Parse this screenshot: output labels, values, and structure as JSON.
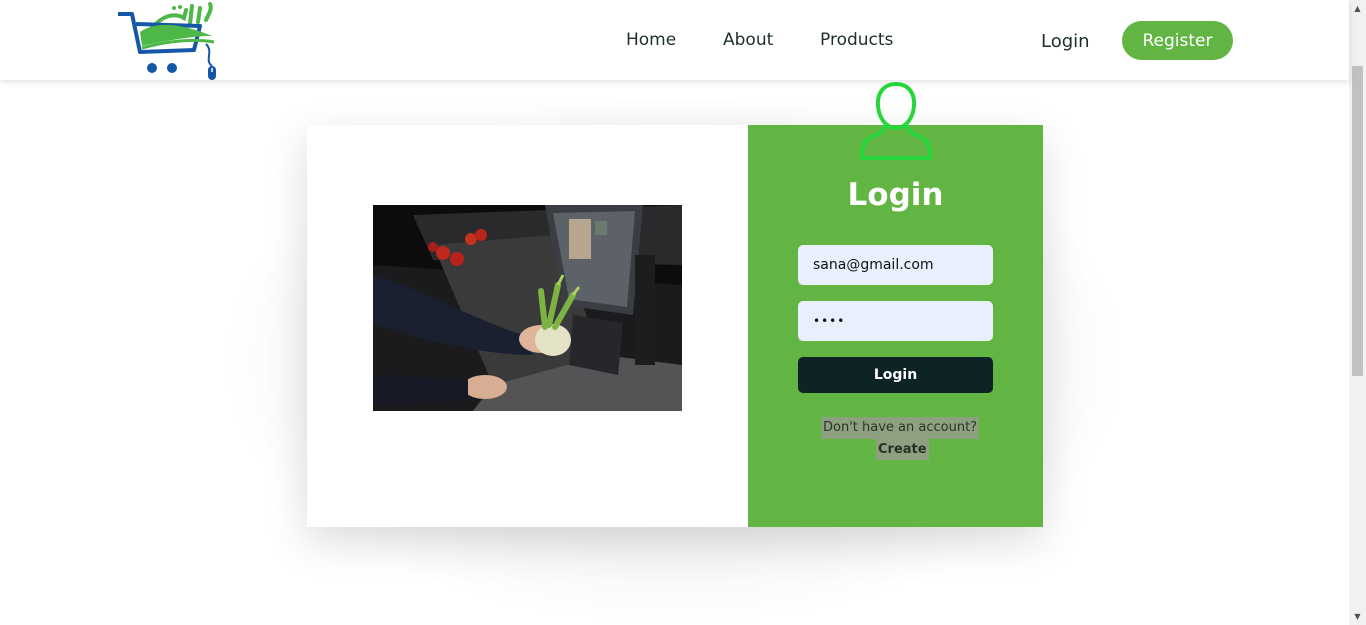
{
  "nav": {
    "links": [
      "Home",
      "About",
      "Products"
    ],
    "login": "Login",
    "register": "Register"
  },
  "login_form": {
    "title": "Login",
    "email_value": "sana@gmail.com",
    "password_value": "••••",
    "submit_label": "Login",
    "signup_question": "Don't have an account?",
    "signup_link": "Create"
  },
  "colors": {
    "brand_green": "#62b543",
    "dark_button": "#0d2326",
    "input_bg": "#e8effd",
    "icon_green": "#27d63b"
  },
  "icons": {
    "logo": "shopping-cart-logo",
    "user": "user-outline-icon"
  }
}
